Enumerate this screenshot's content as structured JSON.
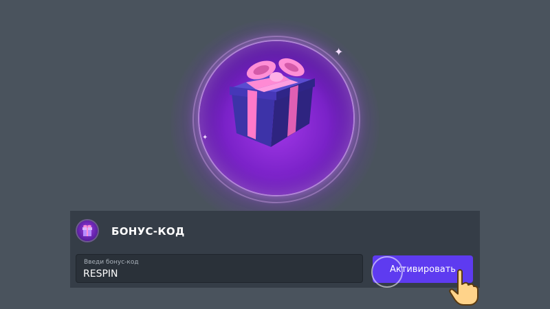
{
  "hero": {
    "image": "gift-box-icon",
    "colors": {
      "orb": "#8a2be2",
      "ribbon": "#ff7fd0",
      "box": "#3a2d9a"
    }
  },
  "bonus_panel": {
    "icon": "gift-badge-icon",
    "title": "БОНУС-КОД",
    "code_input": {
      "label": "Введи бонус-код",
      "value": "RESPIN"
    },
    "activate_button": {
      "label": "Активировать",
      "color": "#5e3bf0"
    },
    "cursor_icon": "pointing-hand-icon"
  }
}
